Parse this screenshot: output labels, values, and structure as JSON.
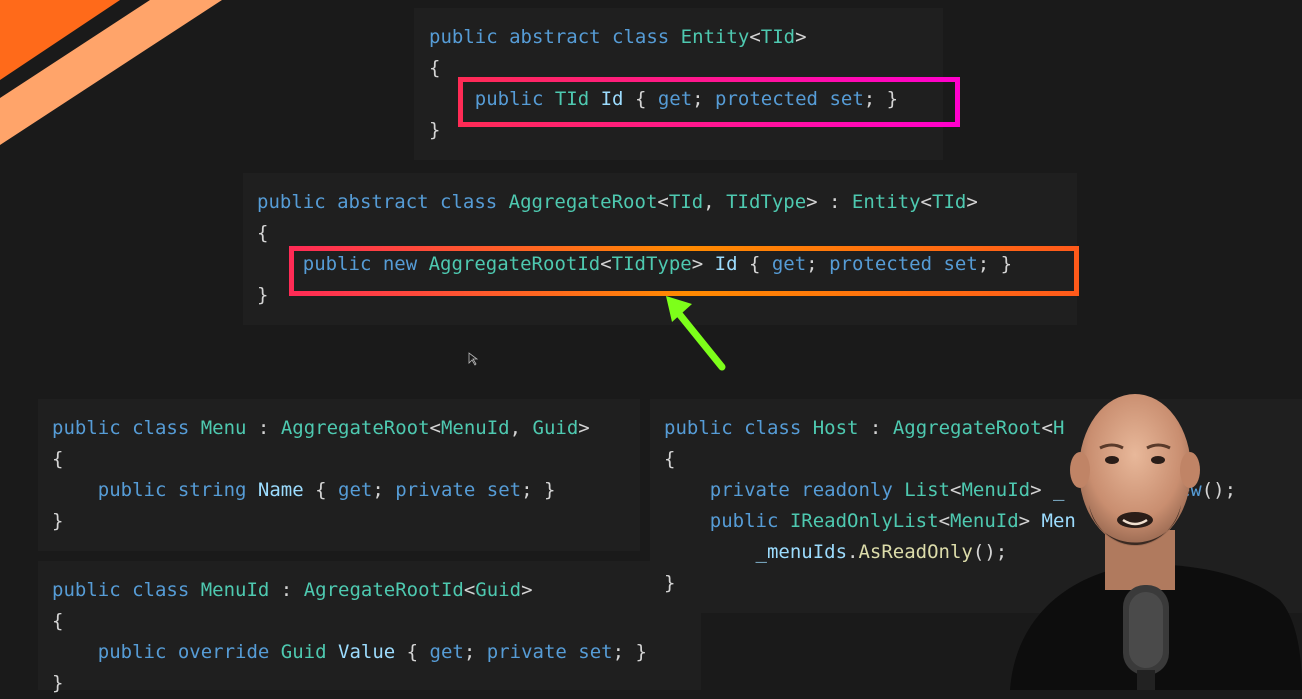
{
  "colors": {
    "keyword": "#569cd6",
    "type": "#4ec9b0",
    "identifier": "#9cdcfe",
    "punctuation": "#d4d4d4",
    "method": "#dcdcaa",
    "highlight_top": "#ff1a8c",
    "highlight_middle": "#ff5a1a",
    "arrow": "#7dff1a",
    "corner_accent": "#ff6a1a"
  },
  "icons": {
    "arrow": "pointing-arrow-icon",
    "cursor": "mouse-cursor-icon"
  },
  "panels": {
    "entity": {
      "lines": [
        [
          [
            "kw",
            "public "
          ],
          [
            "kw",
            "abstract "
          ],
          [
            "kw",
            "class "
          ],
          [
            "ty",
            "Entity"
          ],
          [
            "pl",
            "<"
          ],
          [
            "ty",
            "TId"
          ],
          [
            "pl",
            ">"
          ]
        ],
        [
          [
            "pl",
            "{"
          ]
        ],
        [
          [
            "pl",
            "    "
          ],
          [
            "kw",
            "public "
          ],
          [
            "ty",
            "TId "
          ],
          [
            "id",
            "Id "
          ],
          [
            "pl",
            "{ "
          ],
          [
            "kw",
            "get"
          ],
          [
            "pl",
            "; "
          ],
          [
            "kw",
            "protected "
          ],
          [
            "kw",
            "set"
          ],
          [
            "pl",
            "; }"
          ]
        ],
        [
          [
            "pl",
            "}"
          ]
        ]
      ]
    },
    "aggregate_root": {
      "lines": [
        [
          [
            "kw",
            "public "
          ],
          [
            "kw",
            "abstract "
          ],
          [
            "kw",
            "class "
          ],
          [
            "ty",
            "AggregateRoot"
          ],
          [
            "pl",
            "<"
          ],
          [
            "ty",
            "TId"
          ],
          [
            "pl",
            ", "
          ],
          [
            "ty",
            "TIdType"
          ],
          [
            "pl",
            "> : "
          ],
          [
            "ty",
            "Entity"
          ],
          [
            "pl",
            "<"
          ],
          [
            "ty",
            "TId"
          ],
          [
            "pl",
            ">"
          ]
        ],
        [
          [
            "pl",
            "{"
          ]
        ],
        [
          [
            "pl",
            "    "
          ],
          [
            "kw",
            "public "
          ],
          [
            "kw",
            "new "
          ],
          [
            "ty",
            "AggregateRootId"
          ],
          [
            "pl",
            "<"
          ],
          [
            "ty",
            "TIdType"
          ],
          [
            "pl",
            "> "
          ],
          [
            "id",
            "Id "
          ],
          [
            "pl",
            "{ "
          ],
          [
            "kw",
            "get"
          ],
          [
            "pl",
            "; "
          ],
          [
            "kw",
            "protected "
          ],
          [
            "kw",
            "set"
          ],
          [
            "pl",
            "; }"
          ]
        ],
        [
          [
            "pl",
            "}"
          ]
        ]
      ]
    },
    "menu": {
      "lines": [
        [
          [
            "kw",
            "public "
          ],
          [
            "kw",
            "class "
          ],
          [
            "ty",
            "Menu"
          ],
          [
            "pl",
            " : "
          ],
          [
            "ty",
            "AggregateRoot"
          ],
          [
            "pl",
            "<"
          ],
          [
            "ty",
            "MenuId"
          ],
          [
            "pl",
            ", "
          ],
          [
            "ty",
            "Guid"
          ],
          [
            "pl",
            ">"
          ]
        ],
        [
          [
            "pl",
            "{"
          ]
        ],
        [
          [
            "pl",
            "    "
          ],
          [
            "kw",
            "public "
          ],
          [
            "kw",
            "string "
          ],
          [
            "id",
            "Name "
          ],
          [
            "pl",
            "{ "
          ],
          [
            "kw",
            "get"
          ],
          [
            "pl",
            "; "
          ],
          [
            "kw",
            "private "
          ],
          [
            "kw",
            "set"
          ],
          [
            "pl",
            "; }"
          ]
        ],
        [
          [
            "pl",
            "}"
          ]
        ]
      ]
    },
    "menu_id": {
      "lines": [
        [
          [
            "kw",
            "public "
          ],
          [
            "kw",
            "class "
          ],
          [
            "ty",
            "MenuId"
          ],
          [
            "pl",
            " : "
          ],
          [
            "ty",
            "AgregateRootId"
          ],
          [
            "pl",
            "<"
          ],
          [
            "ty",
            "Guid"
          ],
          [
            "pl",
            ">"
          ]
        ],
        [
          [
            "pl",
            "{"
          ]
        ],
        [
          [
            "pl",
            "    "
          ],
          [
            "kw",
            "public "
          ],
          [
            "kw",
            "override "
          ],
          [
            "ty",
            "Guid "
          ],
          [
            "id",
            "Value "
          ],
          [
            "pl",
            "{ "
          ],
          [
            "kw",
            "get"
          ],
          [
            "pl",
            "; "
          ],
          [
            "kw",
            "private "
          ],
          [
            "kw",
            "set"
          ],
          [
            "pl",
            "; }"
          ]
        ],
        [
          [
            "pl",
            "}"
          ]
        ]
      ]
    },
    "host": {
      "lines": [
        [
          [
            "kw",
            "public "
          ],
          [
            "kw",
            "class "
          ],
          [
            "ty",
            "Host"
          ],
          [
            "pl",
            " : "
          ],
          [
            "ty",
            "AggregateRoot"
          ],
          [
            "pl",
            "<"
          ],
          [
            "ty",
            "H"
          ]
        ],
        [
          [
            "pl",
            "{"
          ]
        ],
        [
          [
            "pl",
            "    "
          ],
          [
            "kw",
            "private "
          ],
          [
            "kw",
            "readonly "
          ],
          [
            "ty",
            "List"
          ],
          [
            "pl",
            "<"
          ],
          [
            "ty",
            "MenuId"
          ],
          [
            "pl",
            "> "
          ],
          [
            "id",
            "_"
          ],
          [
            "pl",
            "       = "
          ],
          [
            "kw",
            "new"
          ],
          [
            "pl",
            "();"
          ]
        ],
        [
          [
            "pl",
            "    "
          ],
          [
            "kw",
            "public "
          ],
          [
            "ty",
            "IReadOnlyList"
          ],
          [
            "pl",
            "<"
          ],
          [
            "ty",
            "MenuId"
          ],
          [
            "pl",
            "> "
          ],
          [
            "id",
            "Men"
          ],
          [
            "pl",
            "    >"
          ]
        ],
        [
          [
            "pl",
            "        "
          ],
          [
            "id",
            "_menuIds"
          ],
          [
            "pl",
            "."
          ],
          [
            "mt",
            "AsReadOnly"
          ],
          [
            "pl",
            "();"
          ]
        ],
        [
          [
            "pl",
            "}"
          ]
        ]
      ]
    }
  }
}
